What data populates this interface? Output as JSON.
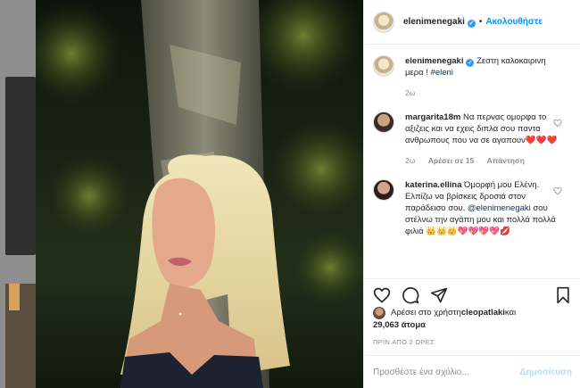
{
  "post": {
    "username": "elenimenegaki",
    "follow_label": "Ακολουθήστε",
    "dot": "•",
    "verified_glyph": "✓"
  },
  "caption": {
    "username": "elenimenegaki",
    "text": "Ζεστη καλοκαιρινη μερα ! ",
    "hashtag": "#eleni",
    "age": "2ω"
  },
  "comments": [
    {
      "username": "margarita18m",
      "text": "Να περνας ομορφα το αξιζεις και να εχεις διπλα σου παντα ανθρωπους που να σε αγαπουν",
      "emoji": "❤️❤️❤️",
      "age": "2ω",
      "likes": "Αρέσει σε 15",
      "reply": "Απάντηση"
    },
    {
      "username": "katerina.ellina",
      "text": "Όμορφή μου Ελένη. Ελπίζω να βρίσκεις δροσιά στον παράδεισο σου.",
      "mention": "@elenimenegaki",
      "text2": " σου στέλνω την αγάπη μου και πολλά πολλά φιλιά ",
      "emoji": "👑👑👑💖💖💖💖💋"
    }
  ],
  "likes": {
    "prefix": "Αρέσει στο χρήστη ",
    "user": "cleopatlaki",
    "mid": " και",
    "count": "29,063 άτομα"
  },
  "timestamp": "ΠΡΙΝ ΑΠΟ 2 ΩΡΕΣ",
  "comment_box": {
    "placeholder": "Προσθέστε ένα σχόλιο...",
    "post_label": "Δημοσίευση"
  },
  "colors": {
    "accent": "#0095f6",
    "verified": "#3897f0",
    "disabled_post": "#b2dffc"
  }
}
